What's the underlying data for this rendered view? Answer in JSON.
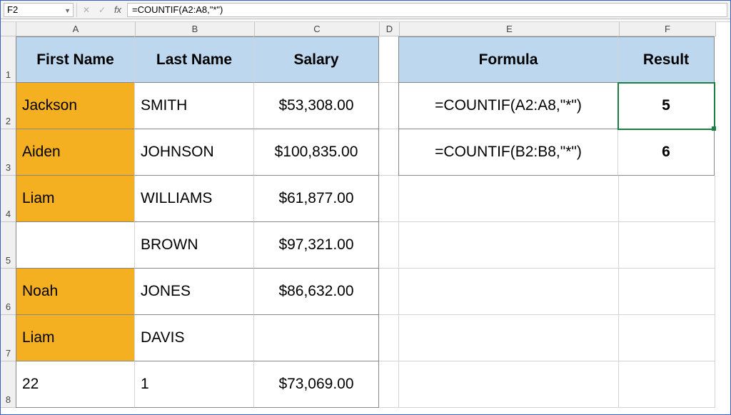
{
  "formula_bar": {
    "name_box": "F2",
    "fx_label": "fx",
    "formula": "=COUNTIF(A2:A8,\"*\")"
  },
  "columns": [
    "A",
    "B",
    "C",
    "D",
    "E",
    "F"
  ],
  "row_numbers": [
    "1",
    "2",
    "3",
    "4",
    "5",
    "6",
    "7",
    "8"
  ],
  "headers": {
    "first_name": "First Name",
    "last_name": "Last Name",
    "salary": "Salary",
    "formula": "Formula",
    "result": "Result"
  },
  "data_rows": [
    {
      "first": "Jackson",
      "last": "SMITH",
      "salary": "$53,308.00",
      "first_hl": true
    },
    {
      "first": "Aiden",
      "last": "JOHNSON",
      "salary": "$100,835.00",
      "first_hl": true
    },
    {
      "first": "Liam",
      "last": "WILLIAMS",
      "salary": "$61,877.00",
      "first_hl": true
    },
    {
      "first": "",
      "last": "BROWN",
      "salary": "$97,321.00",
      "first_hl": false
    },
    {
      "first": "Noah",
      "last": "JONES",
      "salary": "$86,632.00",
      "first_hl": true
    },
    {
      "first": "Liam",
      "last": "DAVIS",
      "salary": "",
      "first_hl": true
    },
    {
      "first": "22",
      "last": "1",
      "salary": "$73,069.00",
      "first_hl": false
    }
  ],
  "formula_rows": [
    {
      "formula": "=COUNTIF(A2:A8,\"*\")",
      "result": "5"
    },
    {
      "formula": "=COUNTIF(B2:B8,\"*\")",
      "result": "6"
    }
  ],
  "selected_cell": "F2",
  "chart_data": {
    "type": "table",
    "title": "COUNTIF text-wildcard example",
    "columns": [
      "First Name",
      "Last Name",
      "Salary"
    ],
    "rows": [
      [
        "Jackson",
        "SMITH",
        53308.0
      ],
      [
        "Aiden",
        "JOHNSON",
        100835.0
      ],
      [
        "Liam",
        "WILLIAMS",
        61877.0
      ],
      [
        "",
        "BROWN",
        97321.0
      ],
      [
        "Noah",
        "JONES",
        86632.0
      ],
      [
        "Liam",
        "DAVIS",
        null
      ],
      [
        22,
        1,
        73069.0
      ]
    ],
    "formulas": [
      {
        "formula": "=COUNTIF(A2:A8,\"*\")",
        "result": 5
      },
      {
        "formula": "=COUNTIF(B2:B8,\"*\")",
        "result": 6
      }
    ]
  }
}
